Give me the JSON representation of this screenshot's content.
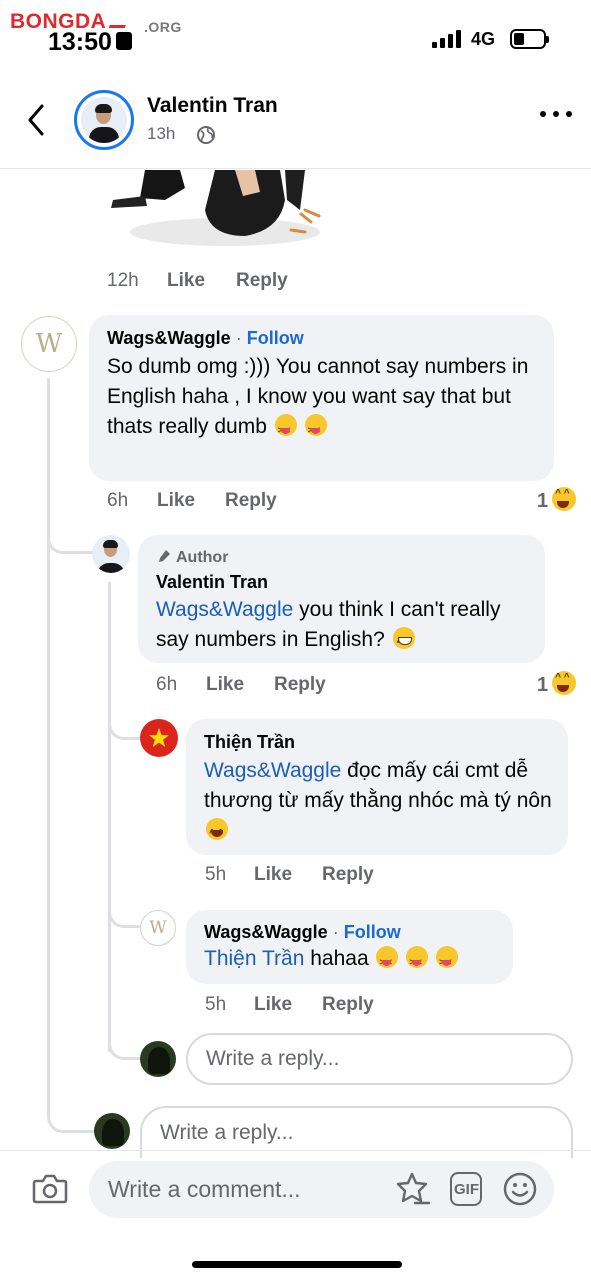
{
  "status_bar": {
    "watermark": "BONGDA",
    "watermark_suffix": ".ORG",
    "time": "13:50",
    "network": "4G"
  },
  "header": {
    "name": "Valentin Tran",
    "time": "13h"
  },
  "previous_comment": {
    "time": "12h",
    "like": "Like",
    "reply": "Reply"
  },
  "comment_1": {
    "author": "Wags&Waggle",
    "sep": "·",
    "follow": "Follow",
    "text": "So dumb omg :))) You cannot say numbers in English haha , I know you want say that but thats really dumb",
    "time": "6h",
    "like": "Like",
    "reply": "Reply",
    "reaction_count": "1"
  },
  "reply_1": {
    "badge": "Author",
    "author": "Valentin Tran",
    "mention": "Wags&Waggle",
    "text": " you think I can't really say numbers in English?",
    "time": "6h",
    "like": "Like",
    "reply": "Reply",
    "reaction_count": "1"
  },
  "reply_2": {
    "author": "Thiện Trần",
    "mention": "Wags&Waggle",
    "text": " đọc mấy cái cmt dễ thương từ mấy thằng nhóc mà tý nôn",
    "time": "5h",
    "like": "Like",
    "reply": "Reply"
  },
  "reply_3": {
    "author": "Wags&Waggle",
    "sep": "·",
    "follow": "Follow",
    "mention": "Thiện Trần",
    "text": " hahaa",
    "time": "5h",
    "like": "Like",
    "reply": "Reply"
  },
  "reply_inputs": {
    "nested_placeholder": "Write a reply...",
    "thread_placeholder": "Write a reply..."
  },
  "composer": {
    "placeholder": "Write a comment...",
    "gif_label": "GIF"
  },
  "colors": {
    "accent": "#1877f2",
    "link": "#1a69d4",
    "bubble": "#f0f2f5",
    "muted": "#65676b",
    "flag_red": "#da251d",
    "watermark_red": "#e0282f"
  },
  "icons": [
    "back-arrow-icon",
    "globe-icon",
    "more-icon",
    "camera-icon",
    "sticker-icon",
    "gif-icon",
    "emoji-icon"
  ]
}
